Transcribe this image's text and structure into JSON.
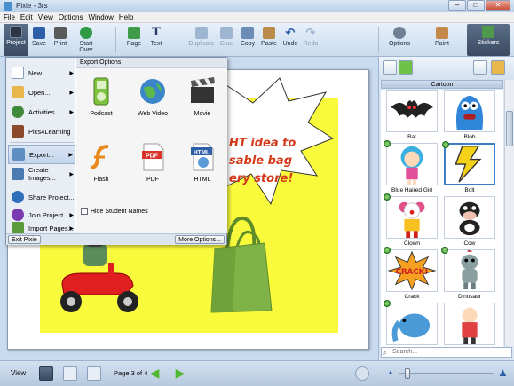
{
  "window": {
    "title": "Pixie - 3rs",
    "min": "–",
    "max": "□",
    "close": "✕"
  },
  "menubar": [
    "File",
    "Edit",
    "View",
    "Options",
    "Window",
    "Help"
  ],
  "toolbar": {
    "project": "Project",
    "save": "Save",
    "print": "Print",
    "start_over": "Start Over",
    "page": "Page",
    "text": "Text",
    "duplicate": "Duplicate",
    "glue": "Glue",
    "copy": "Copy",
    "paste": "Paste",
    "undo": "Undo",
    "redo": "Redo",
    "options": "Options",
    "paint": "Paint",
    "stickers": "Stickers"
  },
  "project_menu": {
    "items": [
      {
        "label": "New",
        "icon": "new-doc-icon"
      },
      {
        "label": "Open...",
        "icon": "folder-icon"
      },
      {
        "label": "Activities",
        "icon": "activities-icon"
      },
      {
        "label": "Pics4Learning",
        "icon": "pics4learning-icon"
      },
      {
        "label": "Export...",
        "icon": "export-icon"
      },
      {
        "label": "Create Images...",
        "icon": "create-images-icon"
      },
      {
        "label": "Share Project...",
        "icon": "share-icon"
      },
      {
        "label": "Join Project...",
        "icon": "join-icon"
      },
      {
        "label": "Import Pages...",
        "icon": "import-icon"
      }
    ],
    "export_header": "Export Options",
    "exports": [
      "Podcast",
      "Web Video",
      "Movie",
      "Flash",
      "PDF",
      "HTML"
    ],
    "hide_student_names": "Hide Student Names",
    "exit": "Exit Pixie",
    "more_options": "More Options..."
  },
  "slide": {
    "line1": "HT idea to",
    "line2": "sable bag",
    "line3": "ery store!"
  },
  "stickers": {
    "category": "Cartoon",
    "items": [
      "Bat",
      "Blob",
      "Blue Haired Girl",
      "Bolt",
      "Clown",
      "Cow",
      "Crack",
      "Dinosaur",
      "",
      ""
    ],
    "search_placeholder": "Search..."
  },
  "bottom": {
    "view": "View",
    "page_label": "Page 3 of 4"
  },
  "colors": {
    "accent": "#3a7fc8",
    "slide_yellow": "#fafa3c",
    "burst_text": "#d43a1a"
  }
}
